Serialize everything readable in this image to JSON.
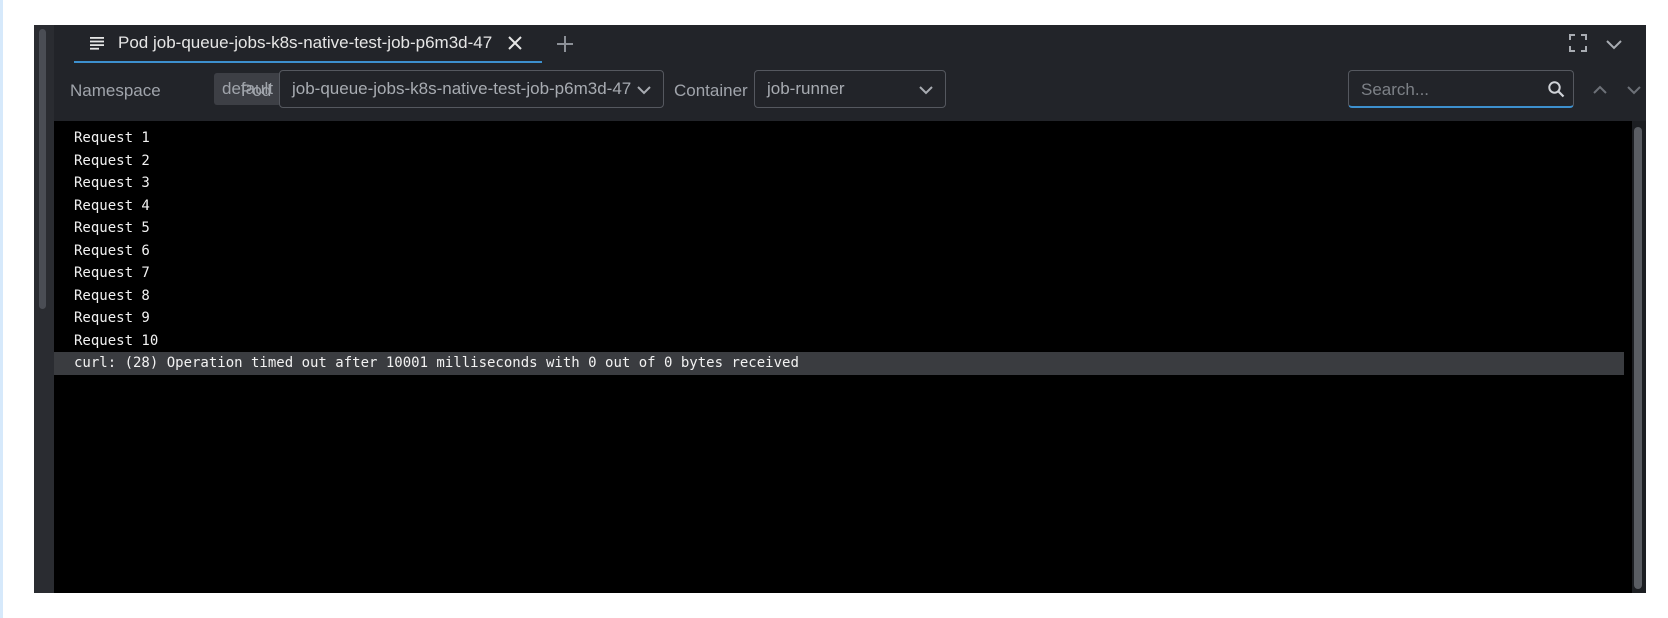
{
  "tab": {
    "label": "Pod job-queue-jobs-k8s-native-test-job-p6m3d-47",
    "icon": "logs-icon"
  },
  "toolbar": {
    "namespace_label": "Namespace",
    "namespace_value": "default",
    "pod_label": "Pod",
    "pod_value": "job-queue-jobs-k8s-native-test-job-p6m3d-47",
    "container_label": "Container",
    "container_value": "job-runner",
    "search_placeholder": "Search..."
  },
  "logs": [
    "Request 1",
    "Request 2",
    "Request 3",
    "Request 4",
    "Request 5",
    "Request 6",
    "Request 7",
    "Request 8",
    "Request 9",
    "Request 10",
    "curl: (28) Operation timed out after 10001 milliseconds with 0 out of 0 bytes received"
  ],
  "colors": {
    "accent": "#3d90ce",
    "panel_bg": "#222429",
    "log_bg": "#000000",
    "highlight_row": "#3a3c40"
  }
}
